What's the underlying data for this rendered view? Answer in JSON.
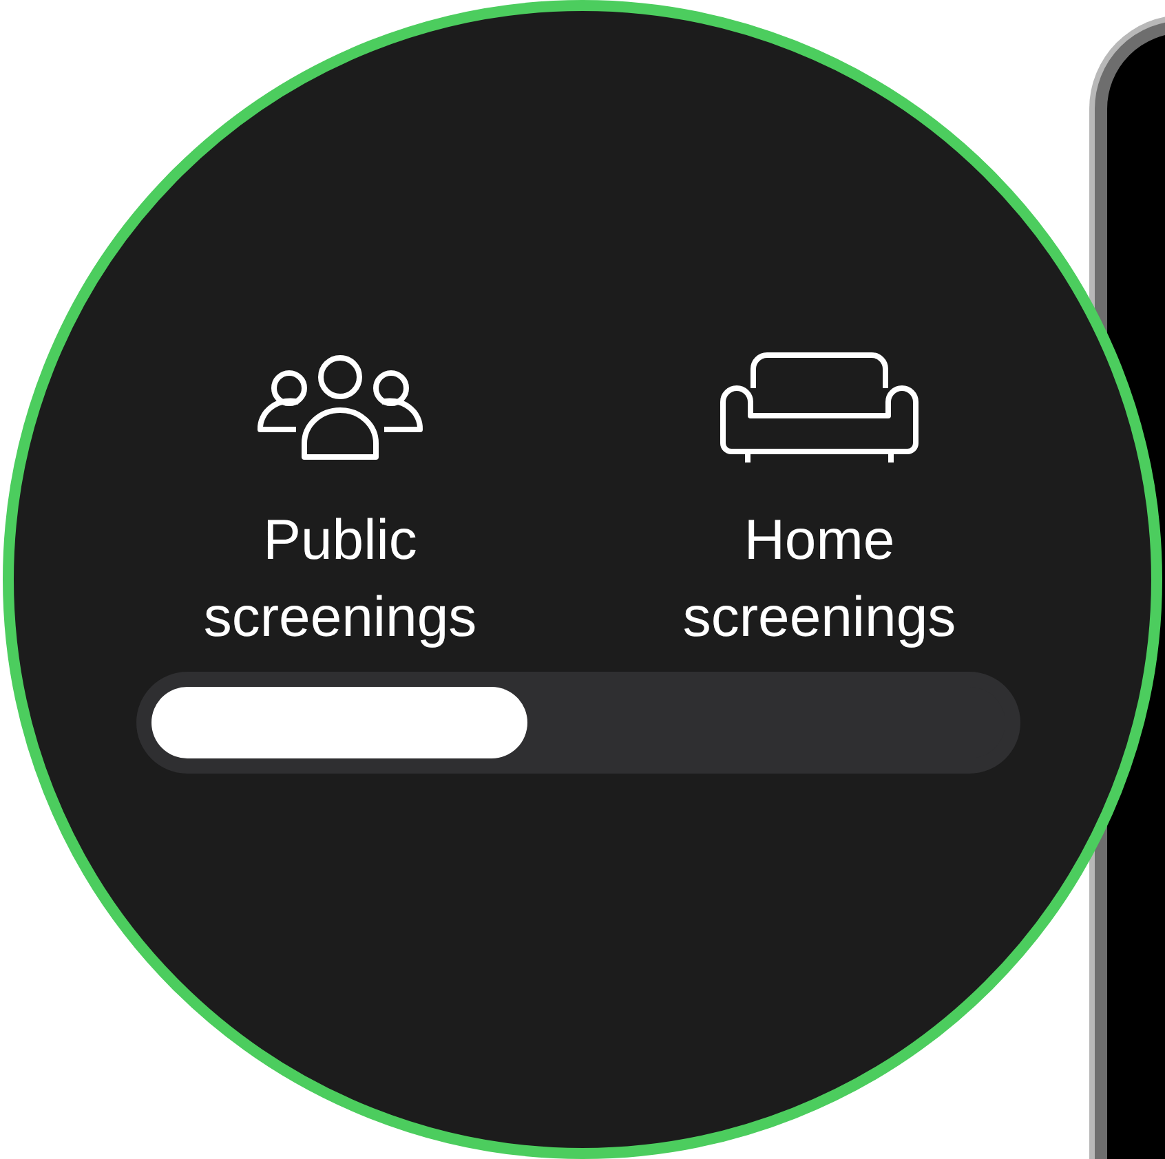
{
  "options": [
    {
      "kind": "public",
      "label": "Public screenings"
    },
    {
      "kind": "home",
      "label": "Home screenings"
    }
  ],
  "slider": {
    "level": 0.44
  }
}
